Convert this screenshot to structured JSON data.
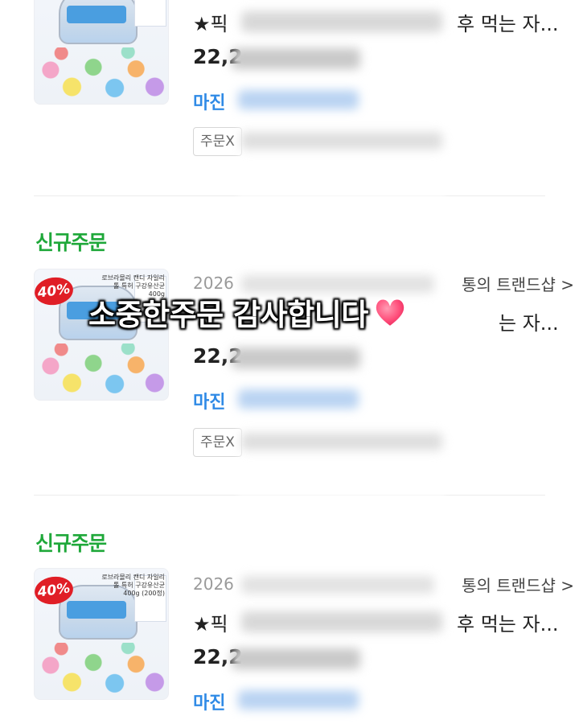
{
  "overlay": {
    "caption": "소중한주문 감사합니다"
  },
  "orders": [
    {
      "badge": "",
      "date": "",
      "shop": "",
      "title_start": "★픽",
      "title_end": "후 먹는 자...",
      "price": "22,2",
      "margin_label": "마진",
      "chip_label": "주문X",
      "thumb": {
        "sale_badge": "",
        "desc": ""
      }
    },
    {
      "badge": "신규주문",
      "date": "2026",
      "shop": "통의 트랜드샵 >",
      "title_start": "",
      "title_end": "는 자...",
      "price": "22,2",
      "margin_label": "마진",
      "chip_label": "주문X",
      "thumb": {
        "sale_badge": "40%",
        "desc": "로브라몰리 캔디 자일리톨 특허 구강유산균 400g"
      }
    },
    {
      "badge": "신규주문",
      "date": "2026",
      "shop": "통의 트랜드샵 >",
      "title_start": "★픽",
      "title_end": "후 먹는 자...",
      "price": "22,2",
      "margin_label": "마진",
      "chip_label": "",
      "thumb": {
        "sale_badge": "40%",
        "desc": "로브라몰리 캔디 자일리톨 특허 구강유산균 400g (200정)"
      }
    }
  ],
  "colors": {
    "badge_green": "#1fa83a",
    "margin_blue": "#2f8ae6",
    "sale_red": "#e01e26",
    "heart_pink": "#ff4f7b"
  }
}
